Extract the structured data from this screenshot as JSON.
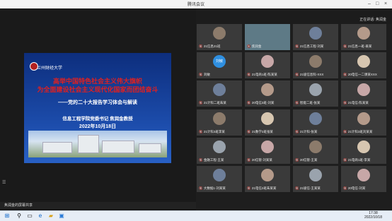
{
  "window": {
    "title": "腾讯会议"
  },
  "slide": {
    "school": "兰州财经大学",
    "title_line1": "高举中国特色社会主义伟大旗帜",
    "title_line2": "为全面建设社会主义现代化国家而团结奋斗",
    "subtitle": "——党的二十大报告学习体会与解读",
    "author": "信息工程学院党委书记 焦润金教授",
    "date": "2022年10月18日"
  },
  "right_panel": {
    "info": "正在讲话: 焦润金"
  },
  "status": {
    "text": "焦润金的屏幕共享"
  },
  "clock": {
    "time": "17:38",
    "date": "2022/10/18"
  },
  "colors": {
    "slide_bg": "#1b4aa8",
    "title_red": "#e02020"
  },
  "participants": [
    {
      "name": "21信息21班",
      "icon": "avatar"
    },
    {
      "name": "焦润金",
      "icon": "video"
    },
    {
      "name": "21信息工程-刘某",
      "icon": "avatar"
    },
    {
      "name": "21信息一班-姜某",
      "icon": "avatar"
    },
    {
      "name": "刘敏",
      "icon": "avatar-text",
      "badge": "刘敏"
    },
    {
      "name": "21电商1班-陈某某",
      "icon": "avatar"
    },
    {
      "name": "21级信息科-XXX",
      "icon": "avatar"
    },
    {
      "name": "20电信一二课某XXX",
      "icon": "avatar"
    },
    {
      "name": "21计科二班朱某",
      "icon": "avatar"
    },
    {
      "name": "20电信3班-刘某",
      "icon": "avatar"
    },
    {
      "name": "智能二班-张某",
      "icon": "avatar"
    },
    {
      "name": "21电信-陈某某",
      "icon": "avatar"
    },
    {
      "name": "21计科3班李某",
      "icon": "avatar"
    },
    {
      "name": "21数学2班张某",
      "icon": "avatar"
    },
    {
      "name": "21计科-张某",
      "icon": "avatar"
    },
    {
      "name": "21计科3班刘某某",
      "icon": "avatar"
    },
    {
      "name": "金融工程-王某",
      "icon": "avatar"
    },
    {
      "name": "20信管-刘某某",
      "icon": "avatar"
    },
    {
      "name": "20信管-王某",
      "icon": "avatar"
    },
    {
      "name": "21电商1班-李某",
      "icon": "avatar"
    },
    {
      "name": "大数据1-刘某某",
      "icon": "avatar"
    },
    {
      "name": "21电信2班朱某某",
      "icon": "avatar"
    },
    {
      "name": "21级信-王某某",
      "icon": "avatar"
    },
    {
      "name": "20电信-刘某",
      "icon": "avatar"
    }
  ]
}
